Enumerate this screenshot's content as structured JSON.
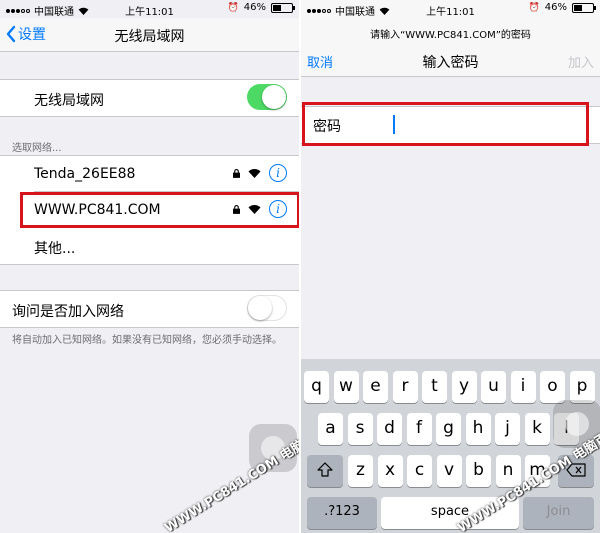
{
  "left": {
    "status": {
      "carrier": "中国联通",
      "time": "上午11:01",
      "battery": "46%",
      "battery_level": 0.46
    },
    "nav": {
      "back_label": "设置",
      "title": "无线局域网"
    },
    "wifi_toggle": {
      "label": "无线局域网",
      "on": true
    },
    "section_header": "选取网络...",
    "networks": [
      {
        "name": "Tenda_26EE88"
      },
      {
        "name": "WWW.PC841.COM"
      },
      {
        "name": "其他..."
      }
    ],
    "ask_join": {
      "label": "询问是否加入网络",
      "on": false
    },
    "footnote": "将自动加入已知网络。如果没有已知网络，您必须手动选择。"
  },
  "right": {
    "status": {
      "carrier": "中国联通",
      "time": "上午11:01",
      "battery": "46%",
      "battery_level": 0.46
    },
    "prompt": "请输入“WWW.PC841.COM”的密码",
    "nav": {
      "cancel_label": "取消",
      "title": "输入密码",
      "join_label": "加入"
    },
    "password_label": "密码",
    "keyboard": {
      "row1": [
        "q",
        "w",
        "e",
        "r",
        "t",
        "y",
        "u",
        "i",
        "o",
        "p"
      ],
      "row2": [
        "a",
        "s",
        "d",
        "f",
        "g",
        "h",
        "j",
        "k",
        "l"
      ],
      "row3": [
        "z",
        "x",
        "c",
        "v",
        "b",
        "n",
        "m"
      ],
      "numbers_label": ".?123",
      "space_label": "space",
      "join_label": "Join"
    }
  },
  "watermark": "WWW.PC841.COM 电脑百事网",
  "colors": {
    "accent": "#007aff",
    "toggle_on": "#4cd964",
    "highlight": "#d7141c"
  }
}
